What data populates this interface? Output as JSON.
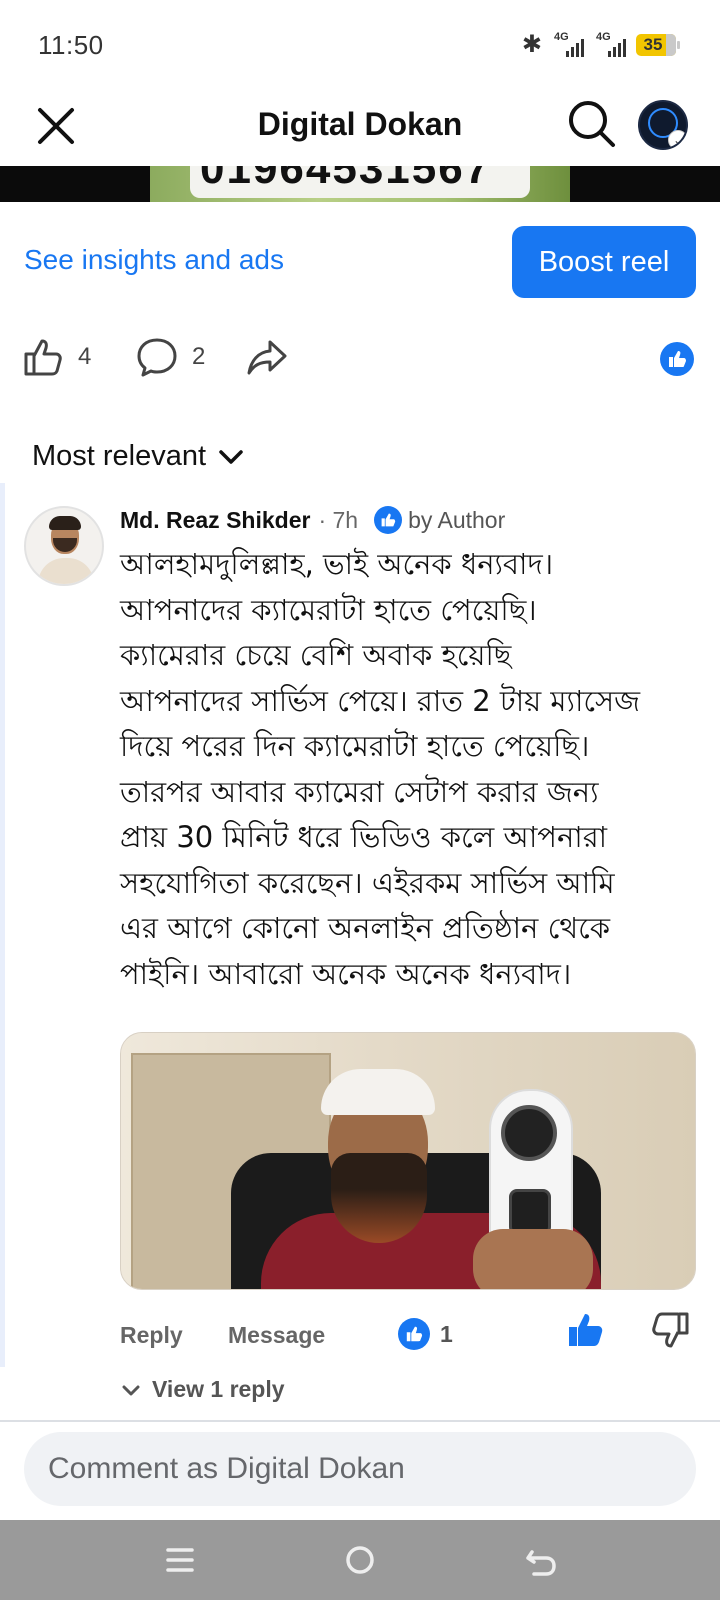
{
  "status_bar": {
    "time": "11:50",
    "network_1": "4G",
    "network_2": "4G",
    "battery": "35"
  },
  "header": {
    "title": "Digital Dokan"
  },
  "video": {
    "overlay_number": "01964531567"
  },
  "insights": {
    "link_label": "See insights and ads",
    "boost_label": "Boost reel"
  },
  "actions": {
    "like_count": "4",
    "comment_count": "2"
  },
  "sort": {
    "label": "Most relevant"
  },
  "comment": {
    "author": "Md. Reaz Shikder",
    "time": "· 7h",
    "badge": "by Author",
    "text": "আলহামদুলিল্লাহ, ভাই অনেক ধন্যবাদ।\nআপনাদের ক্যামেরাটা হাতে পেয়েছি।\nক্যামেরার চেয়ে বেশি অবাক হয়েছি\nআপনাদের সার্ভিস পেয়ে। রাত 2 টায় ম্যাসেজ\nদিয়ে পরের দিন ক্যামেরাটা হাতে পেয়েছি।\nতারপর আবার ক্যামেরা সেটাপ করার জন্য\nপ্রায় 30 মিনিট ধরে ভিডিও কলে আপনারা\nসহযোগিতা করেছেন। এইরকম সার্ভিস আমি\nএর আগে কোনো অনলাইন প্রতিষ্ঠান থেকে\nপাইনি। আবারো অনেক অনেক ধন্যবাদ।",
    "reply_label": "Reply",
    "message_label": "Message",
    "reaction_count": "1",
    "view_replies_label": "View 1 reply"
  },
  "composer": {
    "placeholder": "Comment as Digital Dokan"
  },
  "colors": {
    "accent": "#1877f2",
    "nav_bar": "#9a9a9a"
  }
}
